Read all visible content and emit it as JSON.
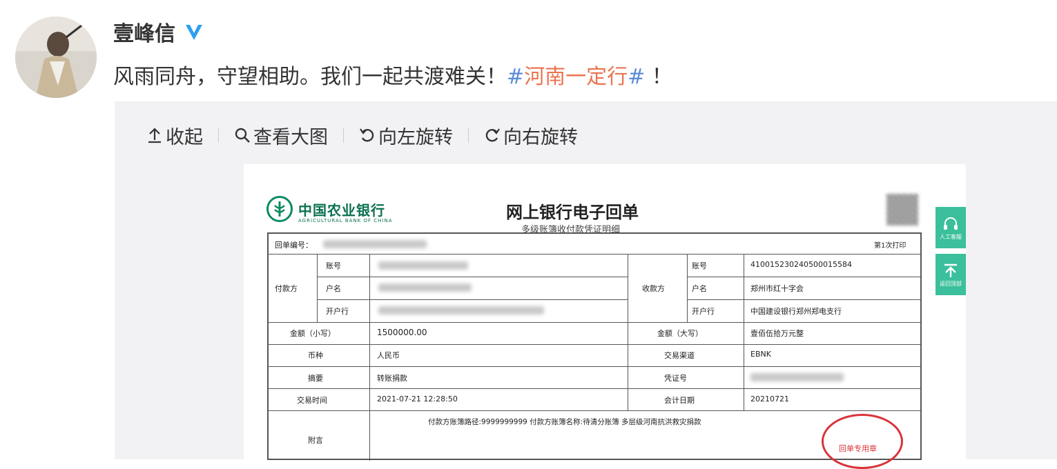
{
  "post": {
    "username": "壹峰信",
    "text_main": "风雨同舟，守望相助。我们一起共渡难关！",
    "hashtag_open": "#",
    "hashtag_body": "河南一定行",
    "hashtag_close": "#",
    "text_end": " ！"
  },
  "toolbar": {
    "collapse_label": "收起",
    "view_large_label": "查看大图",
    "rotate_left_label": "向左旋转",
    "rotate_right_label": "向右旋转"
  },
  "receipt": {
    "bank_name": "中国农业银行",
    "bank_en": "AGRICULTURAL BANK OF CHINA",
    "title": "网上银行电子回单",
    "subtitle": "多级账簿收付款凭证明细",
    "receipt_no_label": "回单编号：",
    "page_indicator": "第1次打印",
    "payer_label": "付款方",
    "payee_label": "收款方",
    "account_label": "账号",
    "name_label": "户名",
    "bank_label": "开户行",
    "payee_account": "410015230240500015584",
    "payee_name": "郑州市红十字会",
    "payee_bank": "中国建设银行郑州郑电支行",
    "amount_small_label": "金额（小写）",
    "amount_small": "1500000.00",
    "amount_big_label": "金额（大写）",
    "amount_big": "壹佰伍拾万元整",
    "currency_label": "币种",
    "currency": "人民币",
    "channel_label": "交易渠道",
    "channel": "EBNK",
    "summary_label": "摘要",
    "summary": "转账捐款",
    "voucher_label": "凭证号",
    "time_label": "交易时间",
    "time": "2021-07-21 12:28:50",
    "acct_date_label": "会计日期",
    "acct_date": "20210721",
    "remark_label": "附言",
    "remark": "付款方账簿路径:9999999999 付款方账簿名称:待清分账簿 多层级河南抗洪救灾捐款",
    "seal_text": "回单专用章"
  },
  "side": {
    "service_label": "人工客服",
    "top_label": "返回顶部"
  },
  "colors": {
    "hashtag_red": "#eb7350",
    "hashtag_blue": "#5b8bd6",
    "bank_green": "#0a8a63",
    "side_teal": "#3bbf9c",
    "seal_red": "#d8333a",
    "verify_blue": "#2d9ff2"
  }
}
